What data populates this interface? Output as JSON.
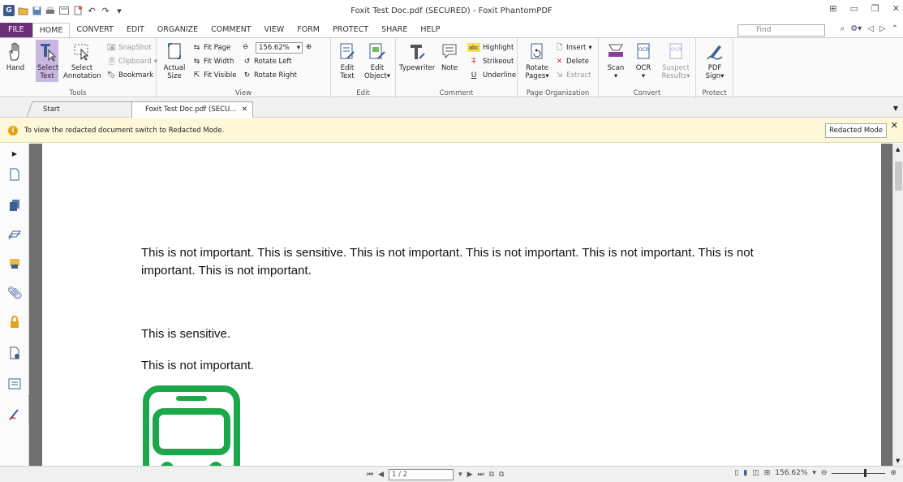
{
  "window": {
    "title": "Foxit Test Doc.pdf (SECURED) - Foxit PhantomPDF",
    "logo": "G"
  },
  "ribbon_tabs": [
    "FILE",
    "HOME",
    "CONVERT",
    "EDIT",
    "ORGANIZE",
    "COMMENT",
    "VIEW",
    "FORM",
    "PROTECT",
    "SHARE",
    "HELP"
  ],
  "active_tab": "HOME",
  "find": {
    "placeholder": "Find"
  },
  "ribbon": {
    "tools": {
      "label": "Tools",
      "hand": "Hand",
      "select_text_1": "Select",
      "select_text_2": "Text",
      "select_annotation_1": "Select",
      "select_annotation_2": "Annotation",
      "snapshot": "SnapShot",
      "clipboard": "Clipboard",
      "bookmark": "Bookmark"
    },
    "view": {
      "label": "View",
      "actual_size_1": "Actual",
      "actual_size_2": "Size",
      "fit_page": "Fit Page",
      "fit_width": "Fit Width",
      "fit_visible": "Fit Visible",
      "zoom": "156.62%",
      "rotate_left": "Rotate Left",
      "rotate_right": "Rotate Right"
    },
    "edit": {
      "label": "Edit",
      "edit_text_1": "Edit",
      "edit_text_2": "Text",
      "edit_object_1": "Edit",
      "edit_object_2": "Object"
    },
    "comment": {
      "label": "Comment",
      "typewriter": "Typewriter",
      "note": "Note",
      "highlight": "Highlight",
      "strikeout": "Strikeout",
      "underline": "Underline"
    },
    "page_org": {
      "label": "Page Organization",
      "rotate_pages_1": "Rotate",
      "rotate_pages_2": "Pages",
      "insert": "Insert",
      "delete": "Delete",
      "extract": "Extract"
    },
    "convert": {
      "label": "Convert",
      "scan": "Scan",
      "ocr": "OCR",
      "suspect_1": "Suspect",
      "suspect_2": "Results"
    },
    "protect": {
      "label": "Protect",
      "pdf_sign_1": "PDF",
      "pdf_sign_2": "Sign"
    }
  },
  "doc_tabs": {
    "start": "Start",
    "doc": "Foxit Test Doc.pdf (SECU..."
  },
  "infobar": {
    "message": "To view the redacted document switch to Redacted Mode.",
    "button": "Redacted Mode"
  },
  "document": {
    "paragraph1": "This is not important. This is sensitive. This is not important. This is not important. This is not important. This is not important. This is not important.",
    "paragraph2": "This is sensitive.",
    "paragraph3": "This is not important."
  },
  "statusbar": {
    "page": "1 / 2",
    "zoom": "156.62%"
  },
  "colors": {
    "file_tab": "#6b2f7a",
    "selected_tool": "#c9b7e3",
    "infobar_bg": "#fdf8d8",
    "bus_icon": "#1aa84a"
  }
}
